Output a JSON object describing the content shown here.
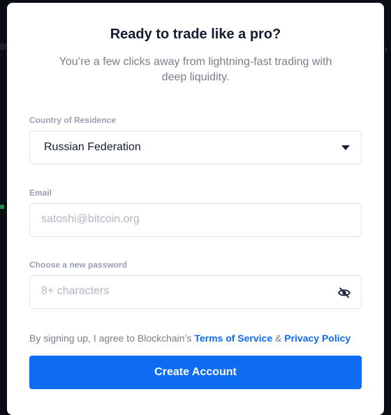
{
  "modal": {
    "title": "Ready to trade like a pro?",
    "subtitle": "You’re a few clicks away from lightning-fast trading with deep liquidity."
  },
  "form": {
    "country": {
      "label": "Country of Residence",
      "value": "Russian Federation"
    },
    "email": {
      "label": "Email",
      "placeholder": "satoshi@bitcoin.org"
    },
    "password": {
      "label": "Choose a new password",
      "placeholder": "8+ characters",
      "visibility_icon": "eye-slash-icon"
    },
    "terms": {
      "prefix": "By signing up, I agree to Blockchain’s ",
      "terms_link": "Terms of Service",
      "separator": " & ",
      "privacy_link": "Privacy Policy"
    },
    "submit_label": "Create Account"
  },
  "colors": {
    "primary": "#0c6cf2",
    "title": "#121d33",
    "muted": "#7a7e8a",
    "label": "#98a1b2"
  }
}
